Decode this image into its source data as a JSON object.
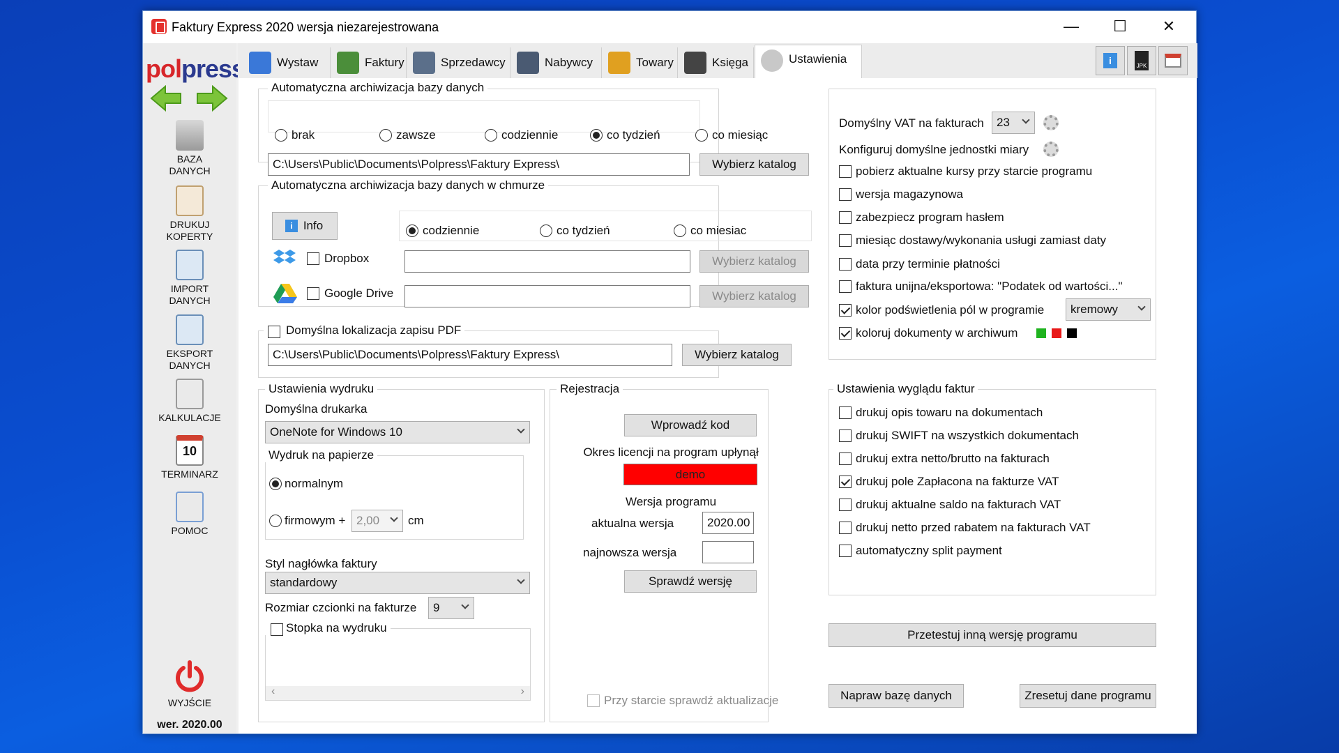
{
  "window": {
    "title": "Faktury Express 2020 wersja niezarejestrowana",
    "minimize": "—",
    "maximize": "☐",
    "close": "✕"
  },
  "logo": {
    "part1": "pol",
    "part2": "press"
  },
  "sidebar": {
    "items": [
      {
        "line1": "BAZA",
        "line2": "DANYCH"
      },
      {
        "line1": "DRUKUJ",
        "line2": "KOPERTY"
      },
      {
        "line1": "IMPORT",
        "line2": "DANYCH"
      },
      {
        "line1": "EKSPORT",
        "line2": "DANYCH"
      },
      {
        "line1": "KALKULACJE",
        "line2": ""
      },
      {
        "line1": "TERMINARZ",
        "line2": ""
      },
      {
        "line1": "POMOC",
        "line2": ""
      }
    ],
    "calendar_day": "10",
    "exit_label": "WYJŚCIE",
    "version": "wer. 2020.00"
  },
  "tabs": [
    {
      "label": "Wystaw"
    },
    {
      "label": "Faktury"
    },
    {
      "label": "Sprzedawcy"
    },
    {
      "label": "Nabywcy"
    },
    {
      "label": "Towary"
    },
    {
      "label": "Księga"
    },
    {
      "label": "Ustawienia"
    }
  ],
  "toolbar": {
    "jpk_label": "JPK"
  },
  "archive": {
    "title": "Automatyczna archiwizacja bazy danych",
    "options": [
      "brak",
      "zawsze",
      "codziennie",
      "co tydzień",
      "co miesiąc"
    ],
    "path": "C:\\Users\\Public\\Documents\\Polpress\\Faktury Express\\",
    "choose_btn": "Wybierz katalog"
  },
  "cloud": {
    "title": "Automatyczna archiwizacja bazy danych w chmurze",
    "info_btn": "Info",
    "options": [
      "codziennie",
      "co tydzień",
      "co miesiac"
    ],
    "dropbox": "Dropbox",
    "gdrive": "Google Drive",
    "choose_btn": "Wybierz katalog"
  },
  "pdf": {
    "title": "Domyślna lokalizacja zapisu PDF",
    "path": "C:\\Users\\Public\\Documents\\Polpress\\Faktury Express\\",
    "choose_btn": "Wybierz katalog"
  },
  "print": {
    "title": "Ustawienia wydruku",
    "printer_label": "Domyślna drukarka",
    "printer_value": "OneNote for Windows 10",
    "paper_title": "Wydruk na papierze",
    "normal": "normalnym",
    "company": "firmowym +",
    "offset_value": "2,00",
    "unit": "cm",
    "header_style_label": "Styl nagłówka faktury",
    "header_style_value": "standardowy",
    "font_size_label": "Rozmiar czcionki na fakturze",
    "font_size_value": "9",
    "footer_label": "Stopka na wydruku",
    "scroll_left": "‹",
    "scroll_right": "›"
  },
  "registration": {
    "title": "Rejestracja",
    "enter_code_btn": "Wprowadź kod",
    "license_expired": "Okres licencji na program upłynął",
    "demo": "demo",
    "version_title": "Wersja programu",
    "current_label": "aktualna wersja",
    "current_value": "2020.00",
    "newest_label": "najnowsza wersja",
    "newest_value": "",
    "check_btn": "Sprawdź wersję",
    "startup_check": "Przy starcie sprawdź aktualizacje"
  },
  "settings": {
    "vat_label": "Domyślny VAT na fakturach",
    "vat_value": "23",
    "units_label": "Konfiguruj domyślne jednostki miary",
    "checks": [
      {
        "label": "pobierz aktualne kursy przy starcie programu",
        "checked": false
      },
      {
        "label": "wersja magazynowa",
        "checked": false
      },
      {
        "label": "zabezpiecz program hasłem",
        "checked": false
      },
      {
        "label": "miesiąc dostawy/wykonania usługi zamiast daty",
        "checked": false
      },
      {
        "label": "data przy terminie płatności",
        "checked": false
      },
      {
        "label": "faktura unijna/eksportowa: \"Podatek od wartości...\"",
        "checked": false
      },
      {
        "label": "kolor podświetlenia pól w programie",
        "checked": true
      },
      {
        "label": "koloruj dokumenty w archiwum",
        "checked": true
      }
    ],
    "highlight_color": "kremowy",
    "archive_colors": [
      "#1fb31f",
      "#e81919",
      "#000000"
    ]
  },
  "appearance": {
    "title": "Ustawienia wyglądu faktur",
    "checks": [
      {
        "label": "drukuj opis towaru na dokumentach",
        "checked": false
      },
      {
        "label": "drukuj SWIFT na wszystkich dokumentach",
        "checked": false
      },
      {
        "label": "drukuj extra netto/brutto na fakturach",
        "checked": false
      },
      {
        "label": "drukuj pole Zapłacona na fakturze VAT",
        "checked": true
      },
      {
        "label": "drukuj aktualne saldo na fakturach VAT",
        "checked": false
      },
      {
        "label": "drukuj netto przed rabatem na fakturach VAT",
        "checked": false
      },
      {
        "label": "automatyczny split payment",
        "checked": false
      }
    ]
  },
  "actions": {
    "test_other": "Przetestuj inną wersję programu",
    "repair_db": "Napraw bazę danych",
    "reset": "Zresetuj dane programu"
  }
}
